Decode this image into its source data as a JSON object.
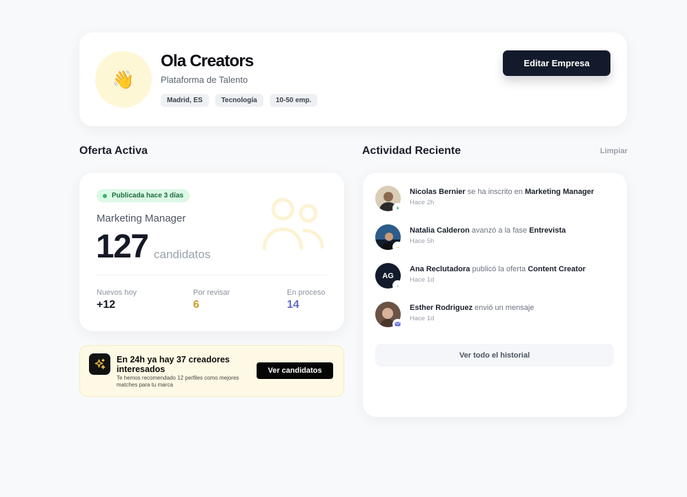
{
  "company": {
    "name": "Ola Creators",
    "subtitle": "Plataforma de Talento",
    "logo_icon": "waving-hand-icon",
    "tags": [
      "Madrid, ES",
      "Tecnología",
      "10-50 emp."
    ],
    "edit_label": "Editar Empresa"
  },
  "active_offer": {
    "section_title": "Oferta Activa",
    "status": "Publicada hace 3 días",
    "role": "Marketing Manager",
    "count": "127",
    "count_label": "candidatos",
    "stats": [
      {
        "label": "Nuevos hoy",
        "value": "+12",
        "color": "#141925"
      },
      {
        "label": "Por revisar",
        "value": "6",
        "color": "#c89d2b"
      },
      {
        "label": "En proceso",
        "value": "14",
        "color": "#5f6dd1"
      }
    ]
  },
  "promo": {
    "title": "En 24h ya hay 37 creadores interesados",
    "subtitle": "Te hemos recomendado 12 perfiles como mejores matches para tu marca",
    "button": "Ver candidatos",
    "icon": "sparkles-icon"
  },
  "activity": {
    "section_title": "Actividad Reciente",
    "clear_label": "Limpiar",
    "items": [
      {
        "actor": "Nicolas Bernier",
        "action": "se ha inscrito en",
        "target": "Marketing Manager",
        "time": "Hace 2h",
        "badge_icon": "plus-icon",
        "badge_color": "#22b462"
      },
      {
        "actor": "Natalia Calderon",
        "action": "avanzó a la fase",
        "target": "Entrevista",
        "time": "Hace 5h",
        "badge_icon": "arrow-right-icon",
        "badge_color": "#e6a23c"
      },
      {
        "actor": "Ana Reclutadora",
        "action": "publicó la oferta",
        "target": "Content Creator",
        "time": "Hace 1d",
        "initials": "AG",
        "badge_icon": "arrow-down-icon",
        "badge_color": "#7b8290"
      },
      {
        "actor": "Esther Rodriguez",
        "action": "envió un mensaje",
        "target": "",
        "time": "Hace 1d",
        "badge_icon": "mail-icon",
        "badge_color": "#5f6dd1"
      }
    ],
    "history_label": "Ver todo el historial"
  },
  "colors": {
    "primary_dark": "#131a2b",
    "page_bg": "#f8f9fb",
    "success": "#33b66a",
    "warning": "#c89d2b",
    "accent": "#5f6dd1"
  }
}
